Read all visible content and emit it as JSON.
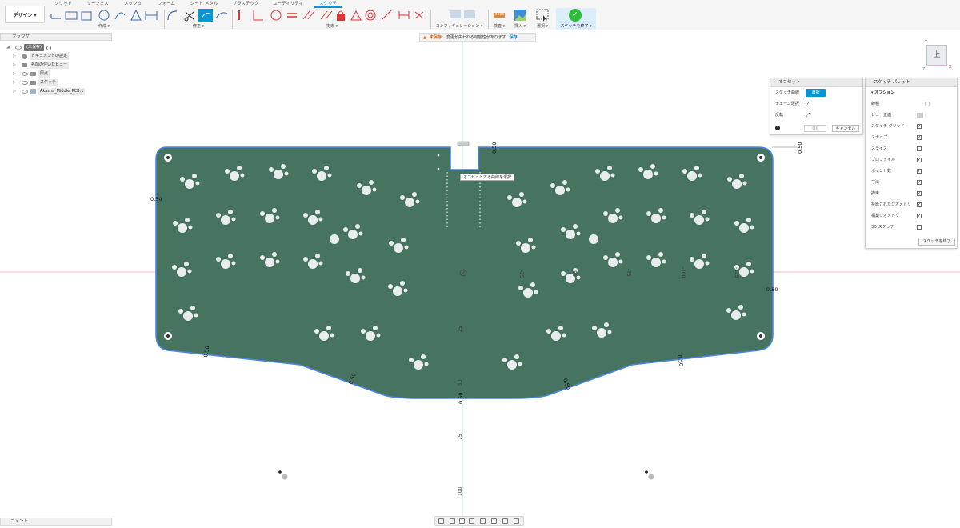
{
  "workspace": {
    "design_label": "デザイン ▾"
  },
  "tabs": [
    "ソリッド",
    "サーフェス",
    "メッシュ",
    "フォーム",
    "シート メタル",
    "プラスチック",
    "ユーティリティ",
    "スケッチ"
  ],
  "groups": {
    "create": "作成 ▾",
    "modify": "修正 ▾",
    "constraints": "拘束 ▾",
    "configure": "コンフィギュレーション ▾",
    "inspect": "検査 ▾",
    "insert": "挿入 ▾",
    "select": "選択 ▾",
    "finish_sketch": "スケッチを終了 ▾"
  },
  "browser": {
    "title": "ブラウザ",
    "items": [
      {
        "label": "(未保存)",
        "kind": "root"
      },
      {
        "label": "ドキュメントの設定",
        "kind": "gear-icon"
      },
      {
        "label": "名前の付いたビュー",
        "kind": "folder-icon"
      },
      {
        "label": "原点",
        "kind": "folder-icon"
      },
      {
        "label": "スケッチ",
        "kind": "folder-icon"
      },
      {
        "label": "Akasha_Middle_PCB:1",
        "kind": "component-icon"
      }
    ]
  },
  "comments": {
    "title": "コメント"
  },
  "banner": {
    "warning": "未保存:",
    "message": "変更が失われる可能性があります",
    "save": "保存"
  },
  "offset_dialog": {
    "title": "オフセット",
    "curves_label": "スケッチ曲線",
    "select_label": "選択",
    "chain_label": "チェーン選択",
    "chain_checked": true,
    "flip_label": "反転",
    "ok": "OK",
    "cancel": "キャンセル"
  },
  "sketch_palette": {
    "title": "スケッチ パレット",
    "section": "▾ オプション",
    "options": [
      {
        "label": "線種",
        "checked": null
      },
      {
        "label": "ビュー正面",
        "checked": null
      },
      {
        "label": "スケッチ グリッド",
        "checked": true
      },
      {
        "label": "スナップ",
        "checked": true
      },
      {
        "label": "スライス",
        "checked": false
      },
      {
        "label": "プロファイル",
        "checked": true
      },
      {
        "label": "ポイント数",
        "checked": true
      },
      {
        "label": "寸法",
        "checked": true
      },
      {
        "label": "拘束",
        "checked": true
      },
      {
        "label": "投影されたジオメトリ",
        "checked": true
      },
      {
        "label": "構築ジオメトリ",
        "checked": true
      },
      {
        "label": "3D スケッチ",
        "checked": false
      }
    ],
    "finish_button": "スケッチを終了"
  },
  "viewcube": {
    "face": "上"
  },
  "tooltip": "オフセットする曲線を選択",
  "dimensions": {
    "left": "0.50",
    "right": "0.50",
    "top_right": "0.50",
    "top_notch": "0.50",
    "bottom_center": "0.50",
    "bottom_left_a": "0.50",
    "bottom_left_b": "0.50",
    "bottom_right_a": "0.50",
    "bottom_right_b": "0.50"
  },
  "axis_ticks": {
    "vertical": [
      "25",
      "50",
      "75",
      "100"
    ],
    "horizontal": [
      "-25",
      "-50",
      "-75",
      "-100",
      "-125"
    ]
  },
  "colors": {
    "pcb_fill": "#477461",
    "pcb_outline": "#4a86e8",
    "accent": "#0696d7",
    "axis_red": "#f4a8a8",
    "axis_green": "#a8e0c0"
  }
}
